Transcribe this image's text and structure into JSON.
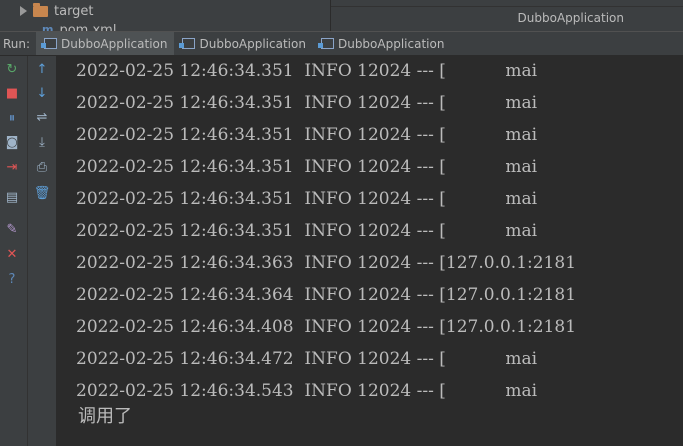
{
  "project_tree": {
    "item_label": "target",
    "next_item_partial": "pom.xml"
  },
  "editor_corner": {
    "title": "DubboApplication"
  },
  "run_panel": {
    "label": "Run:",
    "tabs": [
      {
        "label": "DubboApplication",
        "active": true
      },
      {
        "label": "DubboApplication",
        "active": false
      },
      {
        "label": "DubboApplication",
        "active": false
      }
    ]
  },
  "toolbar": {
    "left_column": [
      {
        "name": "rerun-icon",
        "glyph": "↻",
        "color": "#59a869"
      },
      {
        "name": "stop-icon",
        "glyph": "■",
        "color": "#e05555"
      },
      {
        "name": "pause-icon",
        "glyph": "⏸",
        "color": "#5e88b8"
      },
      {
        "name": "camera-icon",
        "glyph": "◙",
        "color": "#9fb4c8"
      },
      {
        "name": "exit-icon",
        "glyph": "⇥",
        "color": "#e05555"
      },
      {
        "name": "layout-icon",
        "glyph": "▤",
        "color": "#9fb4c8"
      },
      {
        "name": "pin-icon",
        "glyph": "✎",
        "color": "#b69ad0"
      },
      {
        "name": "close-icon",
        "glyph": "✕",
        "color": "#e05555"
      },
      {
        "name": "help-icon",
        "glyph": "?",
        "color": "#5e88b8"
      }
    ],
    "right_column": [
      {
        "name": "scroll-up-icon",
        "glyph": "↑",
        "color": "#5e9fd8"
      },
      {
        "name": "scroll-down-icon",
        "glyph": "↓",
        "color": "#5e9fd8"
      },
      {
        "name": "soft-wrap-icon",
        "glyph": "⇌",
        "color": "#9fb4c8"
      },
      {
        "name": "scroll-to-end-icon",
        "glyph": "⤓",
        "color": "#9fb4c8"
      },
      {
        "name": "print-icon",
        "glyph": "⎙",
        "color": "#9fb4c8"
      },
      {
        "name": "trash-icon",
        "glyph": "🗑",
        "color": "#5e9fd8"
      }
    ]
  },
  "console": {
    "lines": [
      "2022-02-25 12:46:34.351  INFO 12024 --- [           mai",
      "2022-02-25 12:46:34.351  INFO 12024 --- [           mai",
      "2022-02-25 12:46:34.351  INFO 12024 --- [           mai",
      "2022-02-25 12:46:34.351  INFO 12024 --- [           mai",
      "2022-02-25 12:46:34.351  INFO 12024 --- [           mai",
      "2022-02-25 12:46:34.351  INFO 12024 --- [           mai",
      "2022-02-25 12:46:34.363  INFO 12024 --- [127.0.0.1:2181",
      "2022-02-25 12:46:34.364  INFO 12024 --- [127.0.0.1:2181",
      "2022-02-25 12:46:34.408  INFO 12024 --- [127.0.0.1:2181",
      "2022-02-25 12:46:34.472  INFO 12024 --- [           mai",
      "2022-02-25 12:46:34.543  INFO 12024 --- [           mai"
    ],
    "last_output": "调用了"
  }
}
